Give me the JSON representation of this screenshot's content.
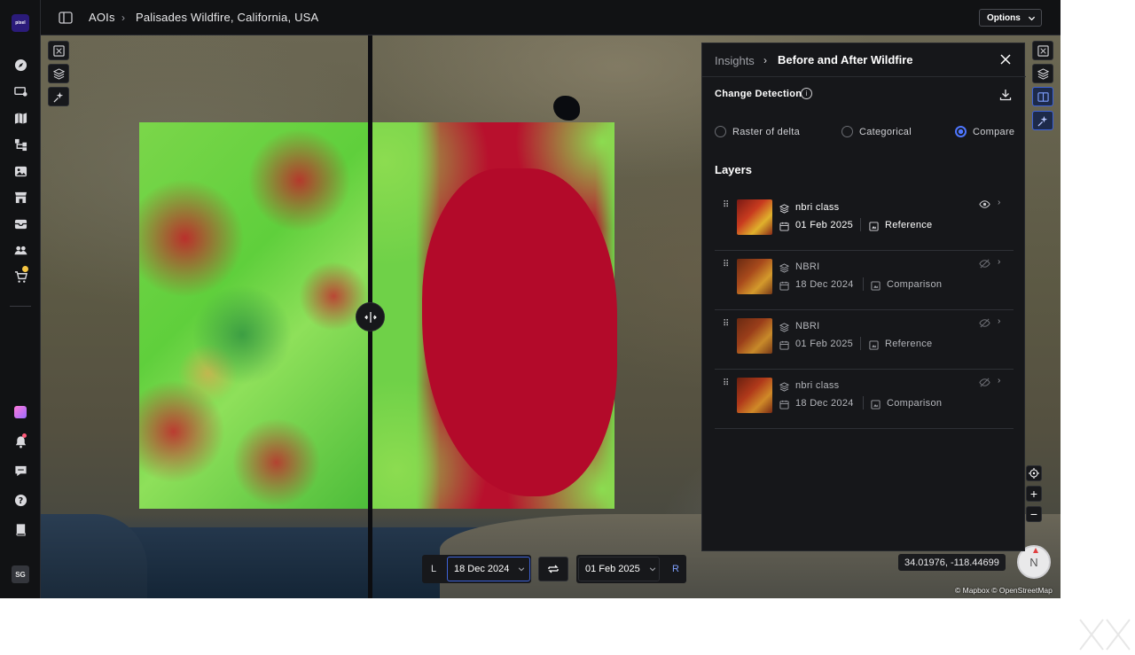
{
  "rail": {
    "logo_text": "pixel",
    "items": [
      "compass-icon",
      "monitor-icon",
      "map-icon",
      "workflow-icon",
      "image-icon",
      "store-icon",
      "archive-icon",
      "team-icon",
      "cart-icon"
    ],
    "bottom_items": [
      "app-icon",
      "bell-icon",
      "chat-icon",
      "help-icon",
      "book-icon"
    ],
    "user_initials": "SG"
  },
  "header": {
    "breadcrumb": [
      "AOIs",
      "Palisades Wildfire, California, USA"
    ],
    "options_label": "Options"
  },
  "map": {
    "coordinates": "34.01976, -118.44699",
    "attribution": "© Mapbox © OpenStreetMap",
    "compass_label": "N",
    "left_tools": [
      "aoi-icon",
      "layers-icon",
      "ai-icon"
    ],
    "right_tools": [
      "aoi-icon",
      "layers-icon",
      "split-view-icon",
      "ai-icon"
    ],
    "zoom_in": "+",
    "zoom_out": "−",
    "compare": {
      "left_letter": "L",
      "left_date": "18 Dec 2024",
      "right_date": "01 Feb 2025",
      "right_letter": "R"
    }
  },
  "panel": {
    "breadcrumb_root": "Insights",
    "title": "Before and After Wildfire",
    "section_title": "Change Detection",
    "modes": [
      {
        "label": "Raster of delta",
        "checked": false
      },
      {
        "label": "Categorical",
        "checked": false
      },
      {
        "label": "Compare",
        "checked": true
      }
    ],
    "layers_title": "Layers",
    "layers": [
      {
        "name": "nbri class",
        "date": "01 Feb 2025",
        "role": "Reference",
        "visible": true
      },
      {
        "name": "NBRI",
        "date": "18 Dec 2024",
        "role": "Comparison",
        "visible": false
      },
      {
        "name": "NBRI",
        "date": "01 Feb 2025",
        "role": "Reference",
        "visible": false
      },
      {
        "name": "nbri class",
        "date": "18 Dec 2024",
        "role": "Comparison",
        "visible": false
      }
    ]
  },
  "colors": {
    "accent": "#3e63d8",
    "radio_on": "#4e76ff",
    "burn": "#b8102d",
    "vegetation": "#6fd148"
  }
}
